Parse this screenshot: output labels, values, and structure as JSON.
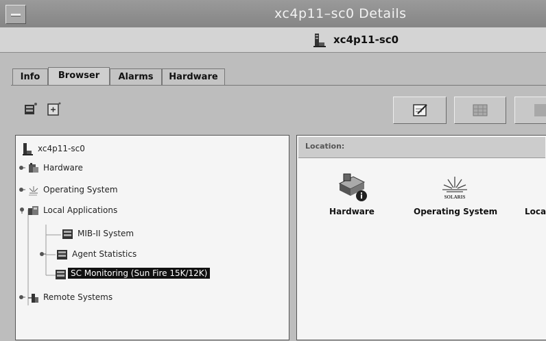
{
  "window": {
    "title": "xc4p11–sc0 Details",
    "host": "xc4p11-sc0"
  },
  "tabs": [
    "Info",
    "Browser",
    "Alarms",
    "Hardware"
  ],
  "tree": {
    "root": "xc4p11-sc0",
    "hardware": "Hardware",
    "operating_system": "Operating System",
    "local_applications": "Local Applications",
    "mib2": "MIB-II System",
    "agent_stats": "Agent Statistics",
    "sc_monitoring": "SC Monitoring (Sun Fire 15K/12K)",
    "remote_systems": "Remote Systems"
  },
  "location": {
    "label": "Location:"
  },
  "objects": {
    "hardware": "Hardware",
    "operating_system": "Operating System",
    "local_partial": "Local",
    "solaris_logo": "SOLARIS"
  },
  "icons": {
    "host": "server-icon",
    "toolbar_left_1": "host-icon",
    "toolbar_left_2": "browser-icon",
    "toolbar_right_1": "edit-icon",
    "toolbar_right_2": "grid-icon"
  }
}
